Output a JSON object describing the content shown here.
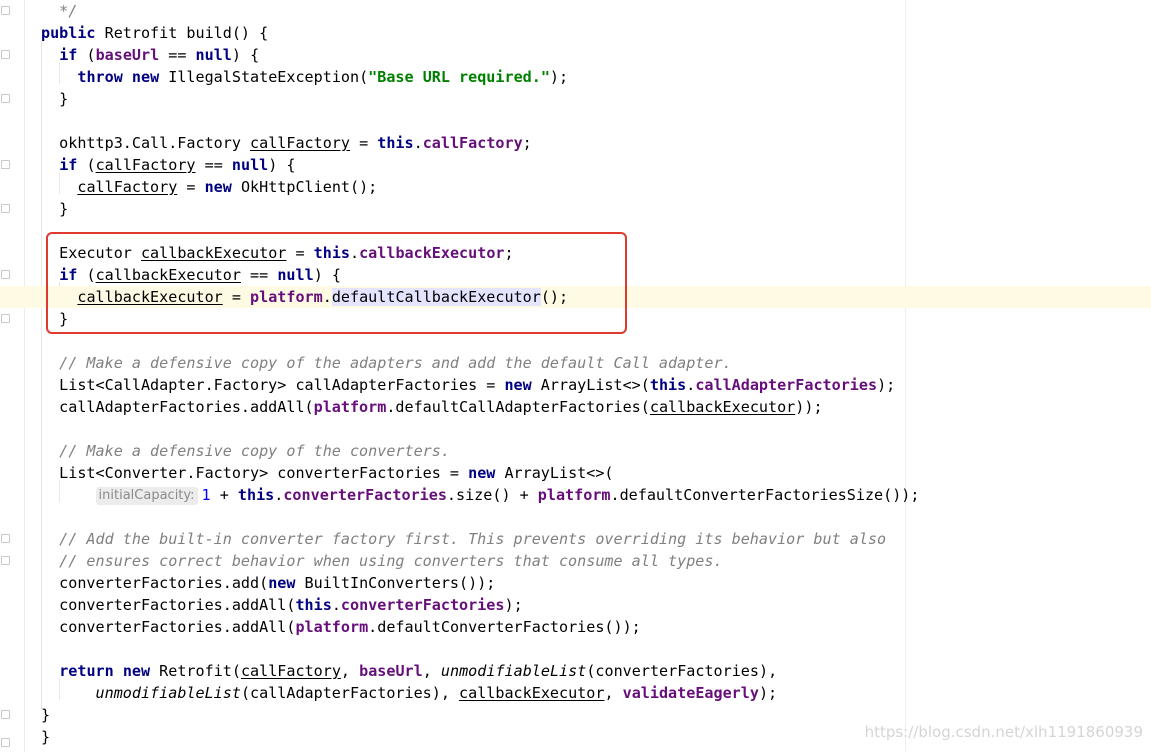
{
  "editor": {
    "lines": [
      [
        {
          "t": "  */",
          "c": "cmt"
        }
      ],
      [
        {
          "t": "public",
          "c": "kw"
        },
        {
          "t": " Retrofit build() {"
        }
      ],
      [
        {
          "t": "  "
        },
        {
          "t": "if",
          "c": "kw"
        },
        {
          "t": " ("
        },
        {
          "t": "baseUrl",
          "c": "fld"
        },
        {
          "t": " == "
        },
        {
          "t": "null",
          "c": "kw"
        },
        {
          "t": ") {"
        }
      ],
      [
        {
          "t": "    "
        },
        {
          "t": "throw",
          "c": "kw"
        },
        {
          "t": " "
        },
        {
          "t": "new",
          "c": "kw"
        },
        {
          "t": " IllegalStateException("
        },
        {
          "t": "\"Base URL required.\"",
          "c": "str"
        },
        {
          "t": ");"
        }
      ],
      [
        {
          "t": "  }"
        }
      ],
      [],
      [
        {
          "t": "  okhttp3.Call.Factory "
        },
        {
          "t": "callFactory",
          "c": "u"
        },
        {
          "t": " = "
        },
        {
          "t": "this",
          "c": "kw"
        },
        {
          "t": "."
        },
        {
          "t": "callFactory",
          "c": "fld"
        },
        {
          "t": ";"
        }
      ],
      [
        {
          "t": "  "
        },
        {
          "t": "if",
          "c": "kw"
        },
        {
          "t": " ("
        },
        {
          "t": "callFactory",
          "c": "u"
        },
        {
          "t": " == "
        },
        {
          "t": "null",
          "c": "kw"
        },
        {
          "t": ") {"
        }
      ],
      [
        {
          "t": "    "
        },
        {
          "t": "callFactory",
          "c": "u"
        },
        {
          "t": " = "
        },
        {
          "t": "new",
          "c": "kw"
        },
        {
          "t": " OkHttpClient();"
        }
      ],
      [
        {
          "t": "  }"
        }
      ],
      [],
      [
        {
          "t": "  Executor "
        },
        {
          "t": "callbackExecutor",
          "c": "u"
        },
        {
          "t": " = "
        },
        {
          "t": "this",
          "c": "kw"
        },
        {
          "t": "."
        },
        {
          "t": "callbackExecutor",
          "c": "fld"
        },
        {
          "t": ";"
        }
      ],
      [
        {
          "t": "  "
        },
        {
          "t": "if",
          "c": "kw"
        },
        {
          "t": " ("
        },
        {
          "t": "callbackExecutor",
          "c": "u"
        },
        {
          "t": " == "
        },
        {
          "t": "null",
          "c": "kw"
        },
        {
          "t": ") {"
        }
      ],
      [
        {
          "t": "    "
        },
        {
          "t": "callbackExecutor",
          "c": "u"
        },
        {
          "t": " = "
        },
        {
          "t": "platform",
          "c": "fld"
        },
        {
          "t": "."
        },
        {
          "t": "defaultCallbackExecutor",
          "c": "sel"
        },
        {
          "t": "();"
        }
      ],
      [
        {
          "t": "  }"
        }
      ],
      [],
      [
        {
          "t": "  // Make a defensive copy of the adapters and add the default Call adapter.",
          "c": "cmt"
        }
      ],
      [
        {
          "t": "  List<CallAdapter.Factory> callAdapterFactories = "
        },
        {
          "t": "new",
          "c": "kw"
        },
        {
          "t": " ArrayList<>("
        },
        {
          "t": "this",
          "c": "kw"
        },
        {
          "t": "."
        },
        {
          "t": "callAdapterFactories",
          "c": "fld"
        },
        {
          "t": ");"
        }
      ],
      [
        {
          "t": "  callAdapterFactories.addAll("
        },
        {
          "t": "platform",
          "c": "fld"
        },
        {
          "t": ".defaultCallAdapterFactories("
        },
        {
          "t": "callbackExecutor",
          "c": "u"
        },
        {
          "t": "));"
        }
      ],
      [],
      [
        {
          "t": "  // Make a defensive copy of the converters.",
          "c": "cmt"
        }
      ],
      [
        {
          "t": "  List<Converter.Factory> converterFactories = "
        },
        {
          "t": "new",
          "c": "kw"
        },
        {
          "t": " ArrayList<>("
        }
      ],
      [
        {
          "t": "      "
        },
        {
          "t": "initialCapacity:",
          "c": "hint"
        },
        {
          "t": "1",
          "c": "num"
        },
        {
          "t": " + "
        },
        {
          "t": "this",
          "c": "kw"
        },
        {
          "t": "."
        },
        {
          "t": "converterFactories",
          "c": "fld"
        },
        {
          "t": ".size() + "
        },
        {
          "t": "platform",
          "c": "fld"
        },
        {
          "t": ".defaultConverterFactoriesSize());"
        }
      ],
      [],
      [
        {
          "t": "  // Add the built-in converter factory first. This prevents overriding its behavior but also",
          "c": "cmt"
        }
      ],
      [
        {
          "t": "  // ensures correct behavior when using converters that consume all types.",
          "c": "cmt"
        }
      ],
      [
        {
          "t": "  converterFactories.add("
        },
        {
          "t": "new",
          "c": "kw"
        },
        {
          "t": " BuiltInConverters());"
        }
      ],
      [
        {
          "t": "  converterFactories.addAll("
        },
        {
          "t": "this",
          "c": "kw"
        },
        {
          "t": "."
        },
        {
          "t": "converterFactories",
          "c": "fld"
        },
        {
          "t": ");"
        }
      ],
      [
        {
          "t": "  converterFactories.addAll("
        },
        {
          "t": "platform",
          "c": "fld"
        },
        {
          "t": ".defaultConverterFactories());"
        }
      ],
      [],
      [
        {
          "t": "  "
        },
        {
          "t": "return",
          "c": "kw"
        },
        {
          "t": " "
        },
        {
          "t": "new",
          "c": "kw"
        },
        {
          "t": " Retrofit("
        },
        {
          "t": "callFactory",
          "c": "u"
        },
        {
          "t": ", "
        },
        {
          "t": "baseUrl",
          "c": "fld"
        },
        {
          "t": ", "
        },
        {
          "t": "unmodifiableList",
          "c": "it"
        },
        {
          "t": "(converterFactories),"
        }
      ],
      [
        {
          "t": "      "
        },
        {
          "t": "unmodifiableList",
          "c": "it"
        },
        {
          "t": "(callAdapterFactories), "
        },
        {
          "t": "callbackExecutor",
          "c": "u"
        },
        {
          "t": ", "
        },
        {
          "t": "validateEagerly",
          "c": "fld"
        },
        {
          "t": ");"
        }
      ],
      [
        {
          "t": "}"
        }
      ],
      [
        {
          "t": "}"
        }
      ]
    ]
  },
  "watermark": "https://blog.csdn.net/xlh1191860939"
}
